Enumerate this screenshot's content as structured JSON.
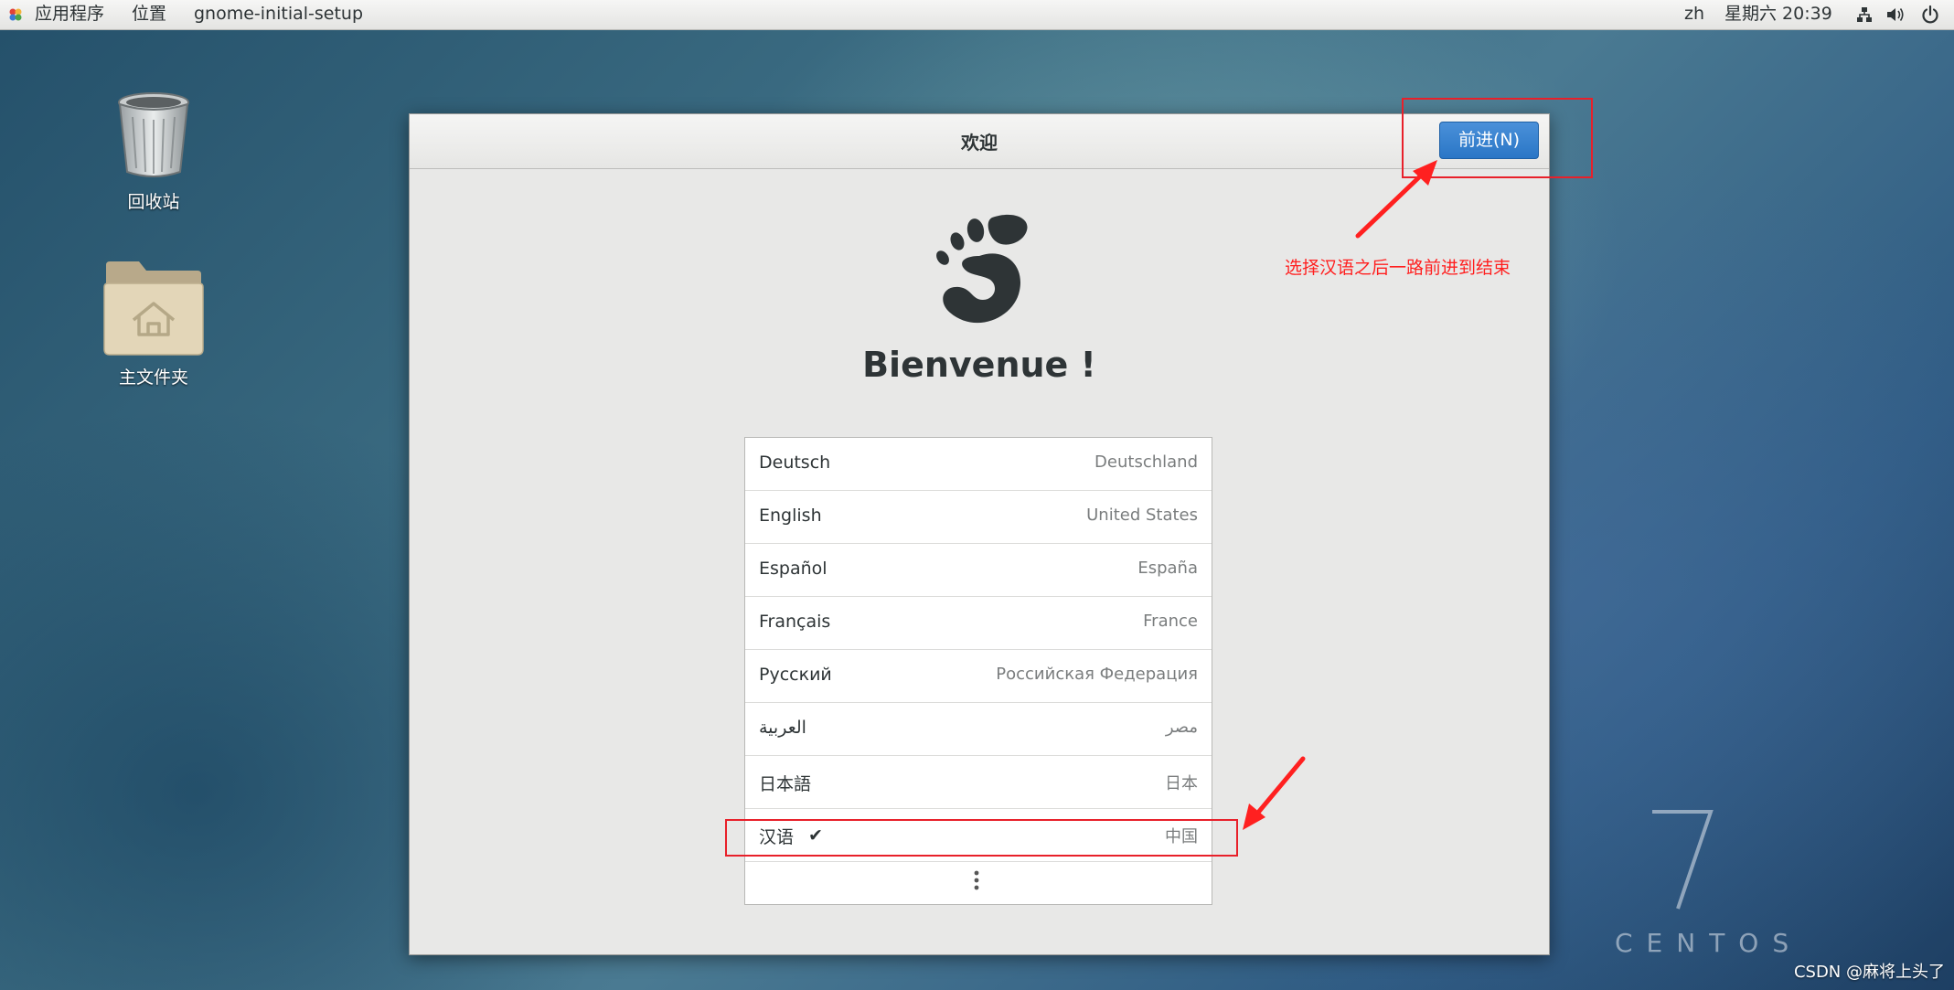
{
  "topbar": {
    "applications": "应用程序",
    "places": "位置",
    "app_name": "gnome-initial-setup",
    "input_method": "zh",
    "datetime": "星期六 20:39"
  },
  "desktop": {
    "trash_label": "回收站",
    "home_label": "主文件夹"
  },
  "dialog": {
    "title": "欢迎",
    "next_button": "前进(N)",
    "welcome_heading": "Bienvenue !",
    "languages": [
      {
        "name": "Deutsch",
        "country": "Deutschland"
      },
      {
        "name": "English",
        "country": "United States"
      },
      {
        "name": "Español",
        "country": "España"
      },
      {
        "name": "Français",
        "country": "France"
      },
      {
        "name": "Русский",
        "country": "Российская Федерация"
      },
      {
        "name": "العربية",
        "country": "مصر"
      },
      {
        "name": "日本語",
        "country": "日本"
      },
      {
        "name": "汉语",
        "country": "中国",
        "selected": true
      }
    ],
    "check_mark": "✔"
  },
  "annotation": {
    "note": "选择汉语之后一路前进到结束",
    "color": "#ff1f1f"
  },
  "watermark": {
    "version": "7",
    "brand": "CENTOS"
  },
  "credit": "CSDN @麻将上头了",
  "colors": {
    "accent_button": "#2a76c6",
    "annotation_red": "#e8202a"
  }
}
